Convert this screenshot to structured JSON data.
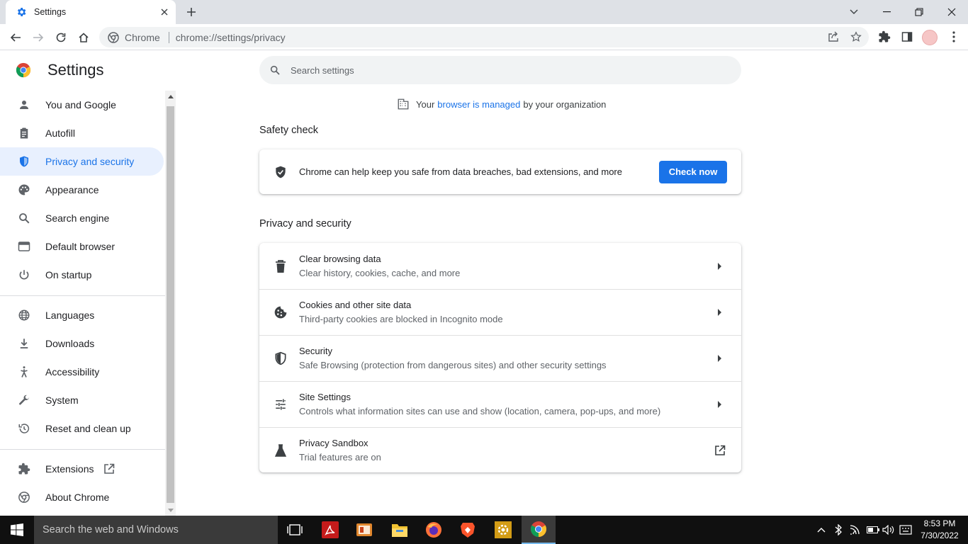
{
  "browser": {
    "tab_title": "Settings",
    "omnibox_site": "Chrome",
    "omnibox_url": "chrome://settings/privacy"
  },
  "sidebar": {
    "brand": "Settings",
    "items": [
      {
        "label": "You and Google",
        "icon": "person-icon"
      },
      {
        "label": "Autofill",
        "icon": "clipboard-icon"
      },
      {
        "label": "Privacy and security",
        "icon": "shield-icon",
        "active": true
      },
      {
        "label": "Appearance",
        "icon": "palette-icon"
      },
      {
        "label": "Search engine",
        "icon": "search-icon"
      },
      {
        "label": "Default browser",
        "icon": "browser-window-icon"
      },
      {
        "label": "On startup",
        "icon": "power-icon"
      },
      {
        "label": "Languages",
        "icon": "globe-icon"
      },
      {
        "label": "Downloads",
        "icon": "download-icon"
      },
      {
        "label": "Accessibility",
        "icon": "accessibility-icon"
      },
      {
        "label": "System",
        "icon": "wrench-icon"
      },
      {
        "label": "Reset and clean up",
        "icon": "history-icon"
      },
      {
        "label": "Extensions",
        "icon": "puzzle-icon"
      },
      {
        "label": "About Chrome",
        "icon": "chrome-icon"
      }
    ]
  },
  "main": {
    "search_placeholder": "Search settings",
    "managed": {
      "prefix": "Your",
      "link": "browser is managed",
      "suffix": "by your organization"
    },
    "safety_check": {
      "title": "Safety check",
      "text": "Chrome can help keep you safe from data breaches, bad extensions, and more",
      "button": "Check now"
    },
    "privacy": {
      "title": "Privacy and security",
      "rows": [
        {
          "title": "Clear browsing data",
          "subtitle": "Clear history, cookies, cache, and more",
          "icon": "trash-icon"
        },
        {
          "title": "Cookies and other site data",
          "subtitle": "Third-party cookies are blocked in Incognito mode",
          "icon": "cookie-icon"
        },
        {
          "title": "Security",
          "subtitle": "Safe Browsing (protection from dangerous sites) and other security settings",
          "icon": "shield-half-icon"
        },
        {
          "title": "Site Settings",
          "subtitle": "Controls what information sites can use and show (location, camera, pop-ups, and more)",
          "icon": "tune-icon"
        },
        {
          "title": "Privacy Sandbox",
          "subtitle": "Trial features are on",
          "icon": "flask-icon"
        }
      ]
    }
  },
  "taskbar": {
    "search_text": "Search the web and Windows",
    "time": "8:53 PM",
    "date": "7/30/2022"
  },
  "colors": {
    "accent": "#1a73e8",
    "active_bg": "#e8f0fe"
  }
}
